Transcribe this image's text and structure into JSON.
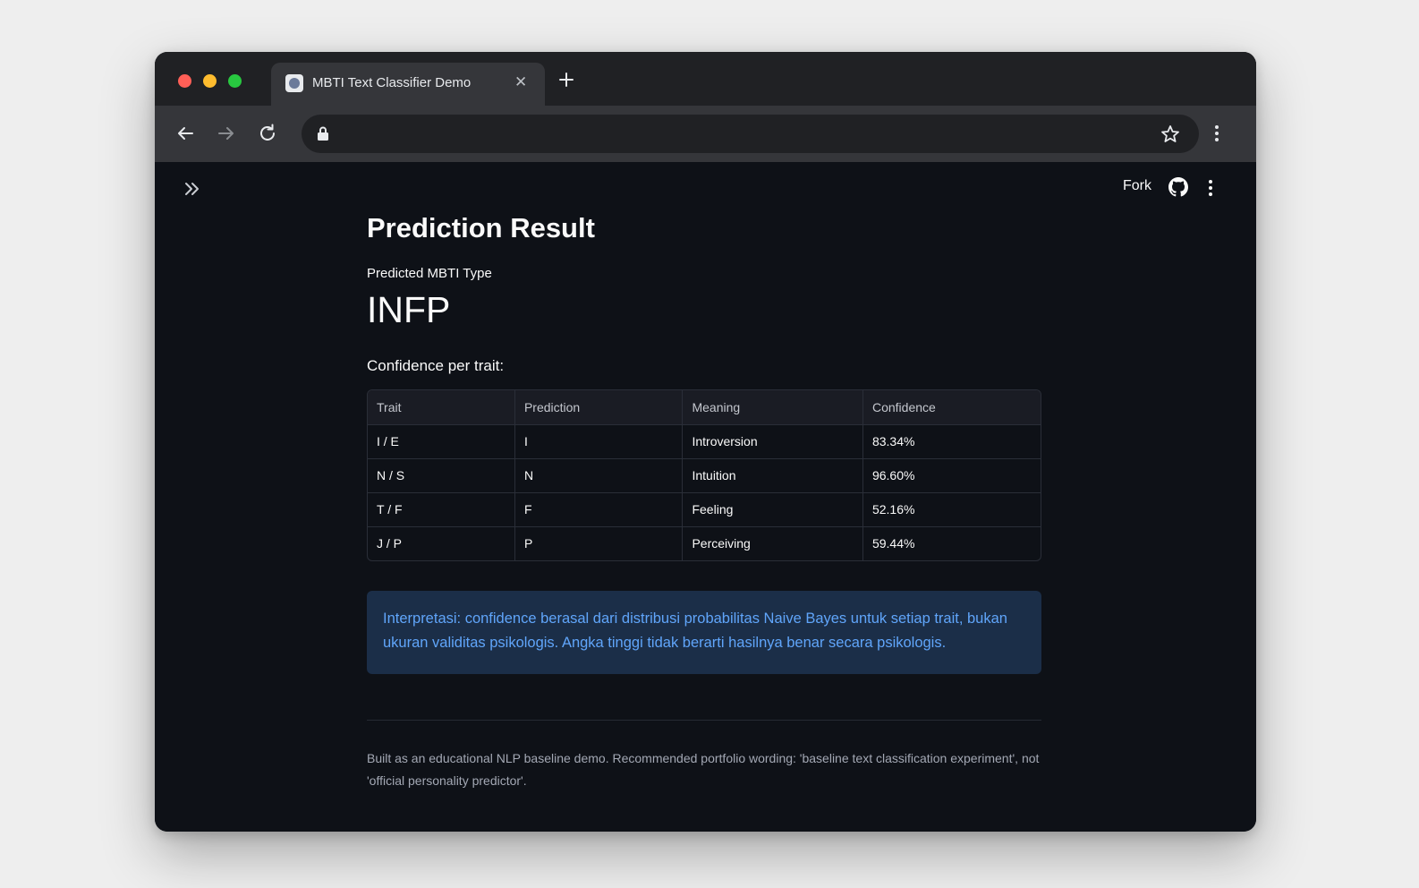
{
  "browser": {
    "tab": {
      "title": "MBTI Text Classifier Demo"
    },
    "address_bar": {
      "url": ""
    }
  },
  "app_header": {
    "fork_label": "Fork"
  },
  "main": {
    "title": "Prediction Result",
    "metric": {
      "label": "Predicted MBTI Type",
      "value": "INFP"
    },
    "table_label": "Confidence per trait:",
    "table": {
      "columns": [
        "Trait",
        "Prediction",
        "Meaning",
        "Confidence"
      ],
      "rows": [
        [
          "I / E",
          "I",
          "Introversion",
          "83.34%"
        ],
        [
          "N / S",
          "N",
          "Intuition",
          "96.60%"
        ],
        [
          "T / F",
          "F",
          "Feeling",
          "52.16%"
        ],
        [
          "J / P",
          "P",
          "Perceiving",
          "59.44%"
        ]
      ]
    },
    "info_text": "Interpretasi: confidence berasal dari distribusi probabilitas Naive Bayes untuk setiap trait, bukan ukuran validitas psikologis. Angka tinggi tidak berarti hasilnya benar secara psikologis.",
    "footer_text": "Built as an educational NLP baseline demo. Recommended portfolio wording: 'baseline text classification experiment', not 'official personality predictor'."
  },
  "colors": {
    "app_background": "#0e1117",
    "info_background": "#1b2e48",
    "info_text": "#60a5fa",
    "browser_chrome": "#35363a"
  },
  "icons": [
    "close-icon",
    "plus-icon",
    "back-arrow-icon",
    "forward-arrow-icon",
    "reload-icon",
    "lock-icon",
    "star-icon",
    "kebab-menu-icon",
    "double-chevron-right-icon",
    "github-icon"
  ]
}
